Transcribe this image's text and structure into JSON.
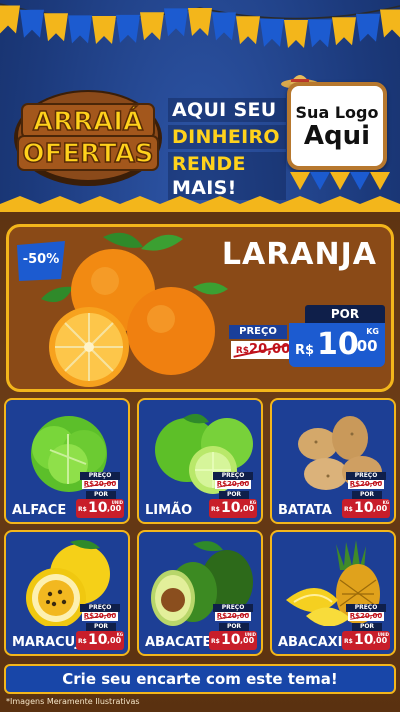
{
  "header": {
    "brand_line1": "ARRAIÁ",
    "brand_line2": "OFERTAS",
    "slogan_line1": "AQUI SEU",
    "slogan_line2": "DINHEIRO",
    "slogan_line3_a": "RENDE",
    "slogan_line3_b": "MAIS!",
    "logo_line1": "Sua Logo",
    "logo_line2": "Aqui"
  },
  "hero": {
    "discount": "-50%",
    "product": "LARANJA",
    "old_label": "PREÇO",
    "old_currency": "R$",
    "old_price": "20,00",
    "por_label": "POR",
    "currency": "R$",
    "price_int": "10",
    "price_dec": ",00",
    "unit": "KG"
  },
  "products": [
    {
      "name": "ALFACE",
      "old_label": "PREÇO",
      "old_currency": "R$",
      "old_price": "20,00",
      "por": "POR",
      "currency": "R$",
      "int": "10",
      "dec": ",00",
      "unit": "UNID"
    },
    {
      "name": "LIMÃO",
      "old_label": "PREÇO",
      "old_currency": "R$",
      "old_price": "20,00",
      "por": "POR",
      "currency": "R$",
      "int": "10",
      "dec": ",00",
      "unit": "KG"
    },
    {
      "name": "BATATA",
      "old_label": "PREÇO",
      "old_currency": "R$",
      "old_price": "20,00",
      "por": "POR",
      "currency": "R$",
      "int": "10",
      "dec": ",00",
      "unit": "KG"
    },
    {
      "name": "MARACUJÁ",
      "old_label": "PREÇO",
      "old_currency": "R$",
      "old_price": "20,00",
      "por": "POR",
      "currency": "R$",
      "int": "10",
      "dec": ",00",
      "unit": "KG"
    },
    {
      "name": "ABACATE",
      "old_label": "PREÇO",
      "old_currency": "R$",
      "old_price": "20,00",
      "por": "POR",
      "currency": "R$",
      "int": "10",
      "dec": ",00",
      "unit": "UNID"
    },
    {
      "name": "ABACAXI",
      "old_label": "PREÇO",
      "old_currency": "R$",
      "old_price": "20,00",
      "por": "POR",
      "currency": "R$",
      "int": "10",
      "dec": ",00",
      "unit": "UNID"
    }
  ],
  "cta": "Crie seu encarte com este tema!",
  "footnote": "*Imagens Meramente Ilustrativas",
  "colors": {
    "background_blue": "#1f3b7a",
    "wood": "#6b3c16",
    "accent_yellow": "#f3b61b",
    "price_blue": "#1c5bd0",
    "price_red": "#c81e2a",
    "card_blue": "#1d3f95"
  }
}
